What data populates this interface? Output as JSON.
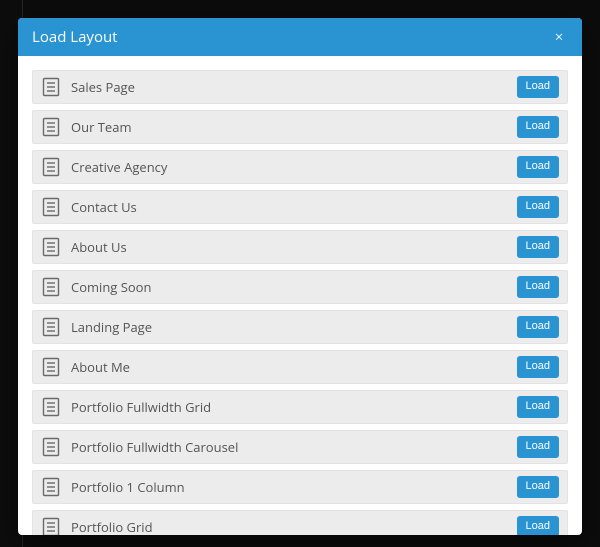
{
  "modal": {
    "title": "Load Layout",
    "close_label": "×",
    "load_button_label": "Load"
  },
  "layouts": [
    {
      "name": "Sales Page"
    },
    {
      "name": "Our Team"
    },
    {
      "name": "Creative Agency"
    },
    {
      "name": "Contact Us"
    },
    {
      "name": "About Us"
    },
    {
      "name": "Coming Soon"
    },
    {
      "name": "Landing Page"
    },
    {
      "name": "About Me"
    },
    {
      "name": "Portfolio Fullwidth Grid"
    },
    {
      "name": "Portfolio Fullwidth Carousel"
    },
    {
      "name": "Portfolio 1 Column"
    },
    {
      "name": "Portfolio Grid"
    }
  ],
  "colors": {
    "accent": "#2994d1",
    "row_bg": "#ececec",
    "text": "#555555"
  }
}
